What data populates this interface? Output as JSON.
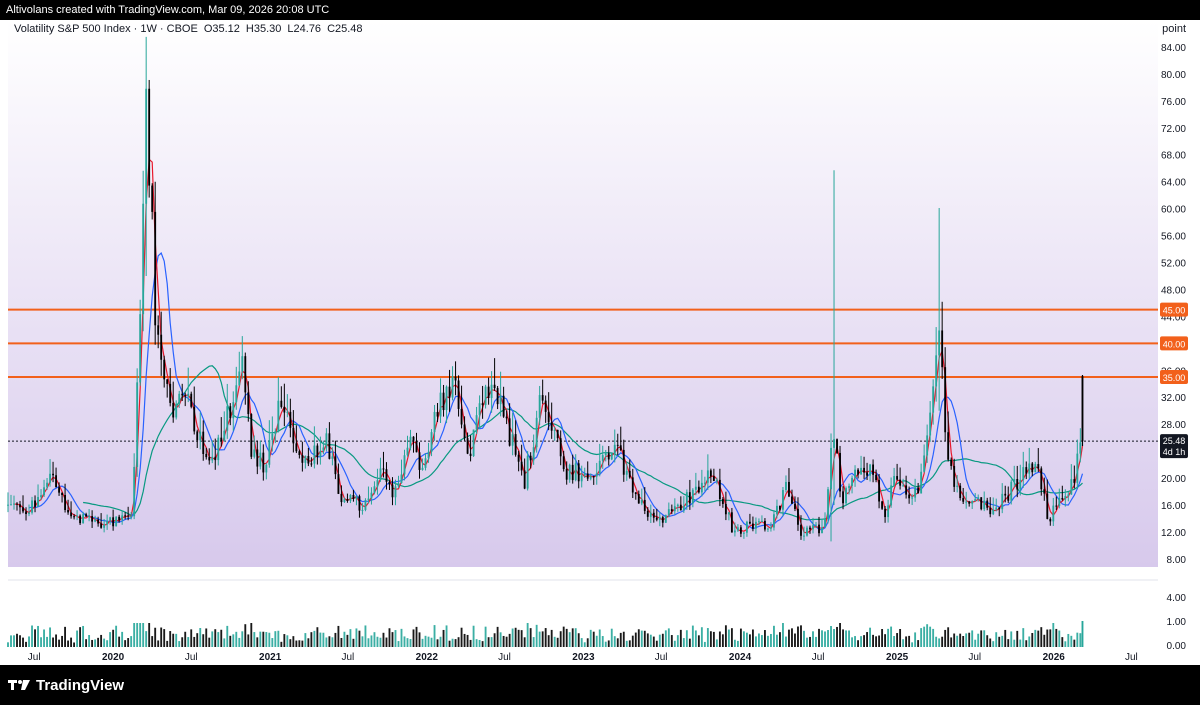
{
  "header": {
    "attribution": "Altivolans created with TradingView.com, Mar 09, 2026 20:08 UTC"
  },
  "legend": {
    "symbol": "Volatility S&P 500 Index · 1W · CBOE",
    "open": "O35.12",
    "high": "H35.30",
    "low": "L24.76",
    "close": "C25.48"
  },
  "axis_unit": "point",
  "footer": {
    "brand": "TradingView"
  },
  "colors": {
    "bg_top": "#ffffff",
    "bg_bottom": "#d7c9ec",
    "level_line": "#f2601b",
    "up": "#26a69a",
    "down": "#000000",
    "ma_fast": "#e8192c",
    "ma_mid": "#2962ff",
    "ma_slow": "#089981"
  },
  "chart_data": {
    "type": "candlestick",
    "title": "Volatility S&P 500 Index · 1W · CBOE",
    "ylabel": "point",
    "ylim": [
      6.8,
      88
    ],
    "y_ticks": [
      8.0,
      12.0,
      16.0,
      20.0,
      24.0,
      28.0,
      32.0,
      36.0,
      40.0,
      44.0,
      48.0,
      52.0,
      56.0,
      60.0,
      64.0,
      68.0,
      72.0,
      76.0,
      80.0,
      84.0
    ],
    "x_ticks": [
      {
        "label": "Jul",
        "x": "2019-07-01"
      },
      {
        "label": "2020",
        "x": "2020-01-01"
      },
      {
        "label": "Jul",
        "x": "2020-07-01"
      },
      {
        "label": "2021",
        "x": "2021-01-01"
      },
      {
        "label": "Jul",
        "x": "2021-07-01"
      },
      {
        "label": "2022",
        "x": "2022-01-01"
      },
      {
        "label": "Jul",
        "x": "2022-07-01"
      },
      {
        "label": "2023",
        "x": "2023-01-01"
      },
      {
        "label": "Jul",
        "x": "2023-07-01"
      },
      {
        "label": "2024",
        "x": "2024-01-01"
      },
      {
        "label": "Jul",
        "x": "2024-07-01"
      },
      {
        "label": "2025",
        "x": "2025-01-01"
      },
      {
        "label": "Jul",
        "x": "2025-07-01"
      },
      {
        "label": "2026",
        "x": "2026-01-01"
      },
      {
        "label": "Jul",
        "x": "2026-07-01"
      }
    ],
    "x_range": [
      "2019-05-01",
      "2026-09-01"
    ],
    "horizontal_levels": [
      {
        "value": 45.0,
        "label": "45.00"
      },
      {
        "value": 40.0,
        "label": "40.00"
      },
      {
        "value": 35.0,
        "label": "35.00"
      }
    ],
    "last_price": {
      "value": 25.48,
      "label": "25.48",
      "countdown": "4d 1h"
    },
    "anchors": [
      [
        "2019-05-01",
        17
      ],
      [
        "2019-06-10",
        15
      ],
      [
        "2019-08-10",
        20
      ],
      [
        "2019-09-15",
        15
      ],
      [
        "2019-10-20",
        14
      ],
      [
        "2019-12-15",
        13
      ],
      [
        "2020-02-15",
        15
      ],
      [
        "2020-03-05",
        45
      ],
      [
        "2020-03-18",
        78
      ],
      [
        "2020-04-10",
        42
      ],
      [
        "2020-05-20",
        30
      ],
      [
        "2020-06-15",
        34
      ],
      [
        "2020-07-20",
        26
      ],
      [
        "2020-08-20",
        22
      ],
      [
        "2020-09-15",
        28
      ],
      [
        "2020-10-30",
        36
      ],
      [
        "2020-11-20",
        23
      ],
      [
        "2020-12-20",
        22
      ],
      [
        "2021-01-28",
        33
      ],
      [
        "2021-03-10",
        22
      ],
      [
        "2021-05-12",
        25
      ],
      [
        "2021-06-15",
        17
      ],
      [
        "2021-08-10",
        16
      ],
      [
        "2021-09-20",
        23
      ],
      [
        "2021-10-15",
        17
      ],
      [
        "2021-11-28",
        28
      ],
      [
        "2021-12-20",
        20
      ],
      [
        "2022-01-25",
        31
      ],
      [
        "2022-03-05",
        34
      ],
      [
        "2022-04-10",
        22
      ],
      [
        "2022-05-10",
        33
      ],
      [
        "2022-06-20",
        32
      ],
      [
        "2022-08-15",
        19
      ],
      [
        "2022-09-28",
        33
      ],
      [
        "2022-11-20",
        21
      ],
      [
        "2022-12-20",
        21
      ],
      [
        "2023-01-20",
        19
      ],
      [
        "2023-03-15",
        26
      ],
      [
        "2023-05-01",
        17
      ],
      [
        "2023-06-20",
        13
      ],
      [
        "2023-08-20",
        16
      ],
      [
        "2023-10-25",
        21
      ],
      [
        "2023-12-15",
        12.5
      ],
      [
        "2024-03-15",
        13
      ],
      [
        "2024-04-18",
        19
      ],
      [
        "2024-05-20",
        12
      ],
      [
        "2024-07-15",
        12.5
      ],
      [
        "2024-08-06",
        28
      ],
      [
        "2024-08-25",
        16
      ],
      [
        "2024-09-10",
        20
      ],
      [
        "2024-10-31",
        22
      ],
      [
        "2024-12-05",
        13.5
      ],
      [
        "2024-12-20",
        20
      ],
      [
        "2025-02-20",
        17
      ],
      [
        "2025-03-12",
        26
      ],
      [
        "2025-04-08",
        45
      ],
      [
        "2025-04-25",
        25
      ],
      [
        "2025-05-20",
        18
      ],
      [
        "2025-07-10",
        16
      ],
      [
        "2025-08-15",
        15
      ],
      [
        "2025-10-15",
        20
      ],
      [
        "2025-11-20",
        22
      ],
      [
        "2025-12-20",
        14
      ],
      [
        "2026-01-25",
        17
      ],
      [
        "2026-02-20",
        21
      ],
      [
        "2026-03-05",
        25
      ]
    ],
    "spikes": [
      {
        "x": "2020-03-16",
        "high": 85.5,
        "low": 50
      },
      {
        "x": "2024-08-05",
        "high": 65.7,
        "low": 16
      },
      {
        "x": "2025-04-07",
        "high": 60.1,
        "low": 30
      },
      {
        "x": "2024-07-29",
        "high": 18,
        "low": 10.6
      }
    ],
    "last_candle": {
      "x": "2026-03-09",
      "open": 35.12,
      "high": 35.3,
      "low": 24.76,
      "close": 25.48
    }
  }
}
